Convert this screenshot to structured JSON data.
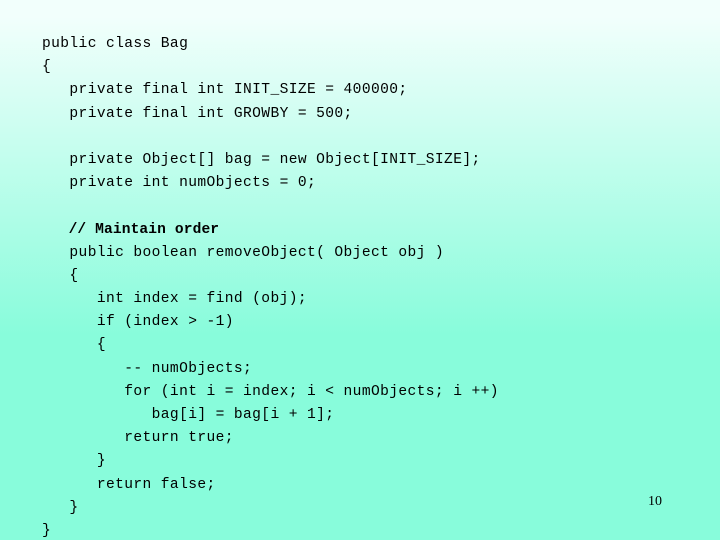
{
  "slide": {
    "background": {
      "top_color": "#f2fffc",
      "bottom_color": "#88fcdb",
      "direction": "vertical"
    },
    "number": "10",
    "code": {
      "language": "java",
      "lines": [
        {
          "text": "public class Bag",
          "style": "plain"
        },
        {
          "text": "{",
          "style": "plain"
        },
        {
          "text": "   private final int INIT_SIZE = 400000;",
          "style": "plain"
        },
        {
          "text": "   private final int GROWBY = 500;",
          "style": "plain"
        },
        {
          "text": "",
          "style": "blank"
        },
        {
          "text": "   private Object[] bag = new Object[INIT_SIZE];",
          "style": "plain"
        },
        {
          "text": "   private int numObjects = 0;",
          "style": "plain"
        },
        {
          "text": "",
          "style": "blank"
        },
        {
          "text": "   // Maintain order",
          "style": "comment"
        },
        {
          "text": "   public boolean removeObject( Object obj )",
          "style": "plain"
        },
        {
          "text": "   {",
          "style": "plain"
        },
        {
          "text": "      int index = find (obj);",
          "style": "plain"
        },
        {
          "text": "      if (index > -1)",
          "style": "plain"
        },
        {
          "text": "      {",
          "style": "plain"
        },
        {
          "text": "         -- numObjects;",
          "style": "plain"
        },
        {
          "text": "         for (int i = index; i < numObjects; i ++)",
          "style": "plain"
        },
        {
          "text": "            bag[i] = bag[i + 1];",
          "style": "plain"
        },
        {
          "text": "         return true;",
          "style": "plain"
        },
        {
          "text": "      }",
          "style": "plain"
        },
        {
          "text": "      return false;",
          "style": "plain"
        },
        {
          "text": "   }",
          "style": "plain"
        },
        {
          "text": "}",
          "style": "plain"
        }
      ]
    }
  }
}
